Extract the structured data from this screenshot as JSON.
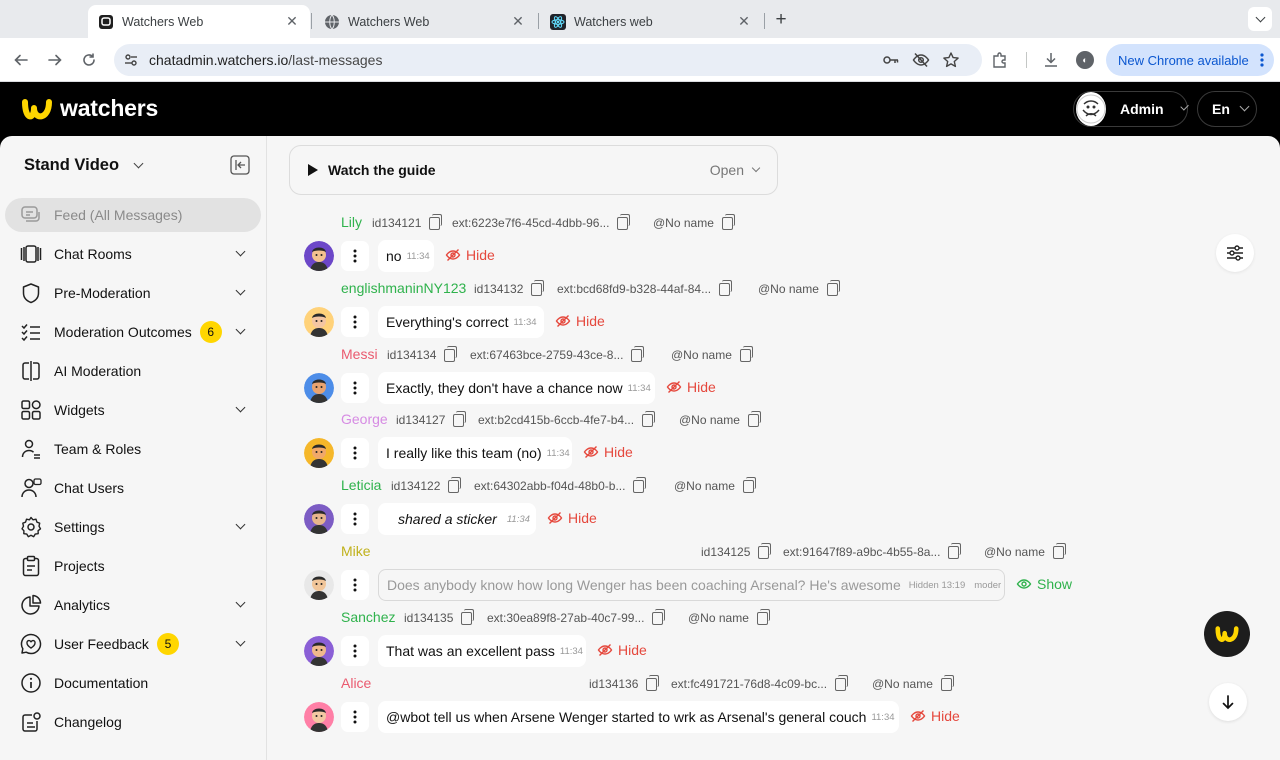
{
  "browser": {
    "tabs": [
      {
        "title": "Watchers Web"
      },
      {
        "title": "Watchers Web"
      },
      {
        "title": "Watchers web"
      }
    ],
    "url_host": "chatadmin.watchers.io",
    "url_path": "/last-messages",
    "update_label": "New Chrome available"
  },
  "header": {
    "brand": "watchers",
    "admin_label": "Admin",
    "lang_label": "En"
  },
  "sidebar": {
    "project_name": "Stand Video",
    "items": [
      {
        "label": "Feed (All Messages)",
        "icon": "feed-icon",
        "active": true
      },
      {
        "label": "Chat Rooms",
        "icon": "chat-rooms-icon",
        "expandable": true
      },
      {
        "label": "Pre-Moderation",
        "icon": "shield-icon",
        "expandable": true
      },
      {
        "label": "Moderation Outcomes",
        "icon": "list-check-icon",
        "badge": "6",
        "expandable": true
      },
      {
        "label": "AI Moderation",
        "icon": "ai-icon"
      },
      {
        "label": "Widgets",
        "icon": "widgets-icon",
        "expandable": true
      },
      {
        "label": "Team & Roles",
        "icon": "team-icon"
      },
      {
        "label": "Chat Users",
        "icon": "users-icon"
      },
      {
        "label": "Settings",
        "icon": "gear-icon",
        "expandable": true
      },
      {
        "label": "Projects",
        "icon": "clipboard-icon"
      },
      {
        "label": "Analytics",
        "icon": "pie-chart-icon",
        "expandable": true
      },
      {
        "label": "User Feedback",
        "icon": "heart-chat-icon",
        "badge": "5",
        "expandable": true
      },
      {
        "label": "Documentation",
        "icon": "info-icon"
      },
      {
        "label": "Changelog",
        "icon": "changelog-icon"
      }
    ]
  },
  "guide": {
    "title": "Watch the guide",
    "open_label": "Open"
  },
  "messages": [
    {
      "name": "Lily",
      "color": "#2fb24c",
      "id": "id134121",
      "ext": "ext:6223e7f6-45cd-4dbb-96...",
      "nick": "@No name",
      "text": "no",
      "time": "11:34",
      "action": "Hide"
    },
    {
      "name": "englishmaninNY123",
      "color": "#2fb24c",
      "id": "id134132",
      "ext": "ext:bcd68fd9-b328-44af-84...",
      "nick": "@No name",
      "text": "Everything's correct",
      "time": "11:34",
      "action": "Hide"
    },
    {
      "name": "Messi",
      "color": "#ea5a6f",
      "id": "id134134",
      "ext": "ext:67463bce-2759-43ce-8...",
      "nick": "@No name",
      "text": "Exactly, they don't have a chance now",
      "time": "11:34",
      "action": "Hide"
    },
    {
      "name": "George",
      "color": "#d68be3",
      "id": "id134127",
      "ext": "ext:b2cd415b-6ccb-4fe7-b4...",
      "nick": "@No name",
      "text": "I really like this team (no)",
      "time": "11:34",
      "action": "Hide"
    },
    {
      "name": "Leticia",
      "color": "#2fb24c",
      "id": "id134122",
      "ext": "ext:64302abb-f04d-48b0-b...",
      "nick": "@No name",
      "text": "shared a sticker",
      "time": "11:34",
      "action": "Hide"
    },
    {
      "name": "Mike",
      "color": "#c0b11a",
      "id": "id134125",
      "ext": "ext:91647f89-a9bc-4b55-8a...",
      "nick": "@No name",
      "text": "Does anybody know how long Wenger has been coaching Arsenal? He's awesome",
      "time": "Hidden 13:19",
      "moder": "moder",
      "action": "Show"
    },
    {
      "name": "Sanchez",
      "color": "#2fb24c",
      "id": "id134135",
      "ext": "ext:30ea89f8-27ab-40c7-99...",
      "nick": "@No name",
      "text": "That was an excellent pass",
      "time": "11:34",
      "action": "Hide"
    },
    {
      "name": "Alice",
      "color": "#ea5a6f",
      "id": "id134136",
      "ext": "ext:fc491721-76d8-4c09-bc...",
      "nick": "@No name",
      "text": "@wbot tell us when Arsene Wenger started to wrk as Arsenal's general couch",
      "time": "11:34",
      "action": "Hide"
    }
  ]
}
